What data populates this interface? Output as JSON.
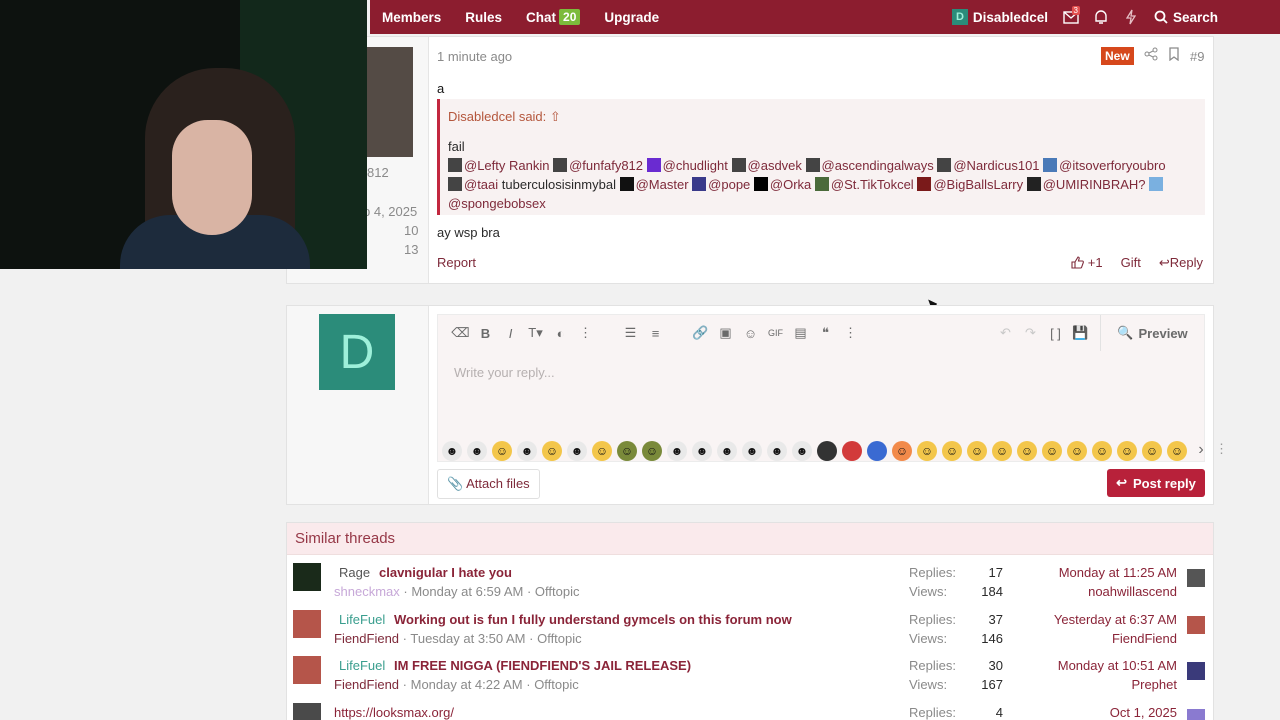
{
  "nav": {
    "items": [
      "Members",
      "Rules",
      "Chat",
      "Upgrade"
    ],
    "chat_badge": "20",
    "user_initial": "D",
    "username": "Disabledcel",
    "inbox_count": "3",
    "search_label": "Search"
  },
  "post": {
    "time": "1 minute ago",
    "new_badge": "New",
    "number": "#9",
    "message_first": "a",
    "stats": [
      "812",
      "p 4, 2025",
      "10",
      "13"
    ],
    "quote": {
      "header": "Disabledcel said:",
      "fail": "fail",
      "line2_a": "@Lefty Rankin",
      "line2_b": "@funfafy812",
      "line2_c": "@chudlight",
      "line2_d": "@asdvek",
      "line2_e": "@ascendingalways",
      "line2_f": "@Nardicus101",
      "line2_g": "@itsoverforyoubro",
      "line3_a": "@taai",
      "line3_b": "tuberculosisinmybal",
      "line3_c": "@Master",
      "line3_d": "@pope",
      "line3_e": "@Orka",
      "line3_f": "@St.TikTokcel",
      "line3_g": "@BigBallsLarry",
      "line3_h": "@UMIRINBRAH?",
      "line4": "@spongebobsex"
    },
    "message_second": "ay wsp bra",
    "report": "Report",
    "like": "+1",
    "gift": "Gift",
    "reply": "Reply"
  },
  "editor": {
    "avatar_initial": "D",
    "placeholder": "Write your reply...",
    "preview": "Preview",
    "attach": "Attach files",
    "post_reply": "Post reply"
  },
  "similar": {
    "heading": "Similar threads",
    "rows": [
      {
        "prefix": "Rage",
        "title": "clavnigular I hate you",
        "author": "shneckmax",
        "date": "Monday at 6:59 AM",
        "forum": "Offtopic",
        "replies": "17",
        "views": "184",
        "last_date": "Monday at 11:25 AM",
        "last_user": "noahwillascend"
      },
      {
        "prefix": "LifeFuel",
        "title": "Working out is fun I fully understand gymcels on this forum now",
        "author": "FiendFiend",
        "date": "Tuesday at 3:50 AM",
        "forum": "Offtopic",
        "replies": "37",
        "views": "146",
        "last_date": "Yesterday at 6:37 AM",
        "last_user": "FiendFiend"
      },
      {
        "prefix": "LifeFuel",
        "title": "IM FREE NIGGA (FIENDFIEND'S JAIL RELEASE)",
        "author": "FiendFiend",
        "date": "Monday at 4:22 AM",
        "forum": "Offtopic",
        "replies": "30",
        "views": "167",
        "last_date": "Monday at 10:51 AM",
        "last_user": "Prephet"
      },
      {
        "prefix": "",
        "title": "https://looksmax.org/",
        "author": "",
        "date": "",
        "forum": "",
        "replies": "4",
        "views": "",
        "last_date": "Oct 1, 2025",
        "last_user": ""
      }
    ],
    "replies_label": "Replies:",
    "views_label": "Views:"
  }
}
